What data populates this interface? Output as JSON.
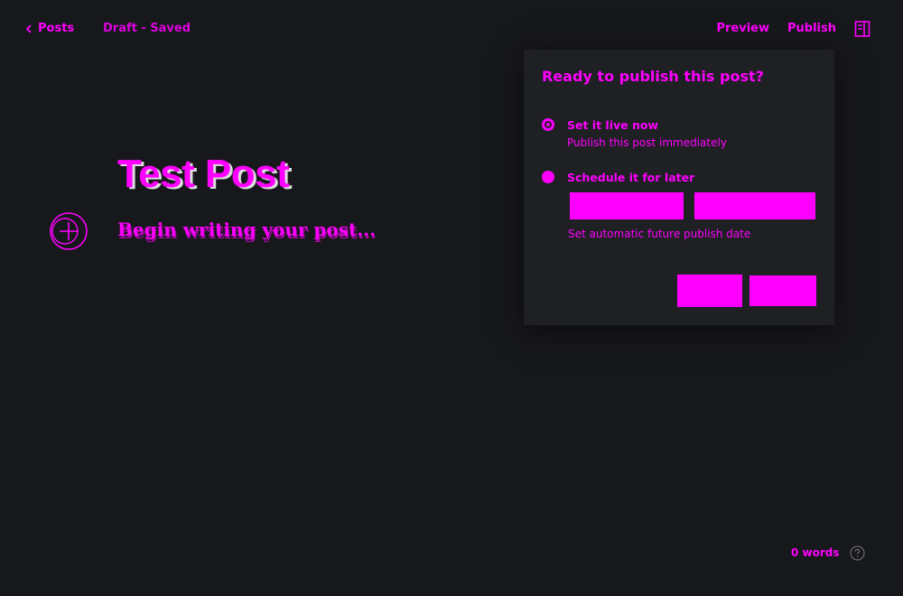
{
  "header": {
    "back_label": "Posts",
    "status": "Draft - Saved",
    "preview_label": "Preview",
    "publish_label": "Publish"
  },
  "editor": {
    "title": "Test Post",
    "body_placeholder": "Begin writing your post..."
  },
  "publish_panel": {
    "title": "Ready to publish this post?",
    "options": [
      {
        "label": "Set it live now",
        "description": "Publish this post immediately",
        "selected": true
      },
      {
        "label": "Schedule it for later",
        "description": "",
        "selected": false
      }
    ],
    "date_value": "",
    "time_value": "",
    "schedule_hint": "Set automatic future publish date",
    "cancel_label": "",
    "confirm_label": ""
  },
  "footer": {
    "word_count": "0 words"
  },
  "colors": {
    "background": "#17181b",
    "panel": "#1f2024",
    "accent": "#ff00ff"
  },
  "icons": {
    "back": "chevron-left-icon",
    "settings": "sidebar-toggle-icon",
    "insert": "plus-circle-icon",
    "help": "question-circle-icon"
  }
}
